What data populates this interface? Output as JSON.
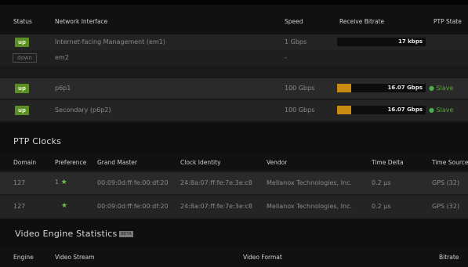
{
  "interfaces": {
    "headers": [
      "Status",
      "Network Interface",
      "Speed",
      "Receive Bitrate",
      "PTP State"
    ],
    "rows": [
      {
        "status": "up",
        "name": "Internet-facing Management (em1)",
        "speed": "1 Gbps",
        "bitrate": "17 kbps",
        "fill": 0.0,
        "ptp": ""
      },
      {
        "status": "down",
        "name": "em2",
        "speed": "-",
        "bitrate": "",
        "fill": null,
        "ptp": ""
      },
      {
        "status": "up",
        "name": "p6p1",
        "speed": "100 Gbps",
        "bitrate": "16.07 Gbps",
        "fill": 0.16,
        "ptp": "Slave"
      },
      {
        "status": "up",
        "name": "Secondary (p6p2)",
        "speed": "100 Gbps",
        "bitrate": "16.07 Gbps",
        "fill": 0.16,
        "ptp": "Slave"
      }
    ]
  },
  "ptp_clocks": {
    "title": "PTP Clocks",
    "headers": [
      "Domain",
      "Preference",
      "Grand Master",
      "Clock Identity",
      "Vendor",
      "Time Delta",
      "Time Source"
    ],
    "rows": [
      {
        "domain": "127",
        "preference": "1",
        "grand_master": "00:09:0d:ff:fe:00:df:20",
        "clock_identity": "24:8a:07:ff:fe:7e:3e:c8",
        "vendor": "Mellanox Technologies, Inc.",
        "time_delta": "0.2 µs",
        "time_source": "GPS (32)"
      },
      {
        "domain": "127",
        "preference": "",
        "grand_master": "00:09:0d:ff:fe:00:df:20",
        "clock_identity": "24:8a:07:ff:fe:7e:3e:c8",
        "vendor": "Mellanox Technologies, Inc.",
        "time_delta": "0.2 µs",
        "time_source": "GPS (32)"
      }
    ]
  },
  "video_engine": {
    "title": "Video Engine Statistics",
    "badge": "BETA",
    "headers": [
      "Engine",
      "Video Stream",
      "Video Format",
      "Bitrate"
    ]
  },
  "colors": {
    "up": "#5b8f24",
    "bar": "#c98a12",
    "slave": "#5aa03a",
    "star": "#6ec04a"
  }
}
